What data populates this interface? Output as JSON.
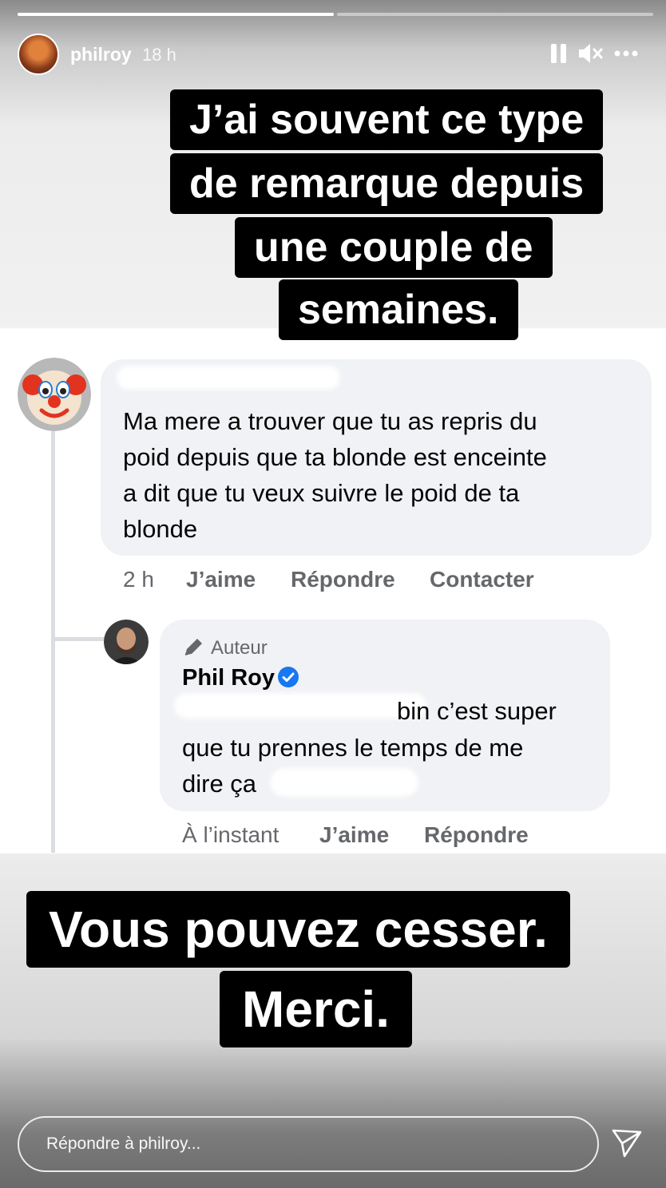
{
  "story": {
    "progress": [
      1.0,
      0.0
    ],
    "user": "philroy",
    "time": "18 h",
    "icons": [
      "pause-icon",
      "mute-icon",
      "more-icon"
    ]
  },
  "captions": {
    "top": [
      "J’ai souvent ce type",
      "de remarque depuis",
      "une couple de",
      "semaines."
    ],
    "bottom": [
      "Vous pouvez cesser.",
      "Merci."
    ]
  },
  "comment": {
    "text": [
      "Ma mere a trouver que tu as repris du",
      "poid depuis que ta blonde est enceinte",
      "a dit que tu veux suivre le poid de ta",
      "blonde"
    ],
    "time": "2 h",
    "like": "J’aime",
    "reply": "Répondre",
    "contact": "Contacter"
  },
  "reply": {
    "badge": "Auteur",
    "author": "Phil Roy",
    "text": [
      "bin c’est super",
      "que tu prennes le temps de me",
      "dire ça"
    ],
    "time": "À l’instant",
    "like": "J’aime",
    "reply": "Répondre"
  },
  "footer": {
    "placeholder": "Répondre à philroy..."
  },
  "colors": {
    "verified": "#1877f2",
    "bubble": "#f0f2f5",
    "meta": "#65676b"
  }
}
